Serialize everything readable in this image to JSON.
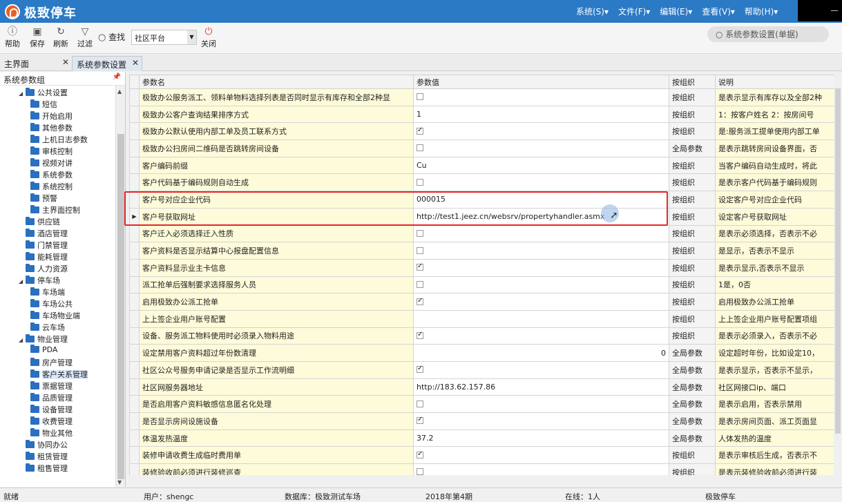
{
  "app": {
    "title": "极致停车"
  },
  "menu": [
    "系统(S)▾",
    "文件(F)▾",
    "编辑(E)▾",
    "查看(V)▾",
    "帮助(H)▾"
  ],
  "toolbar": {
    "help": "帮助",
    "save": "保存",
    "refresh": "刷新",
    "filter": "过滤",
    "search": "查找",
    "platform_value": "社区平台",
    "close": "关闭",
    "global_search": "系统参数设置(单据)"
  },
  "tabs": [
    {
      "label": "主界面"
    },
    {
      "label": "系统参数设置"
    }
  ],
  "sidebar": {
    "header": "系统参数组",
    "items": [
      "公共设置",
      "短信",
      "开始启用",
      "其他参数",
      "上机日志参数",
      "审核控制",
      "视频对讲",
      "系统参数",
      "系统控制",
      "预警",
      "主界面控制",
      "供应链",
      "酒店管理",
      "门禁管理",
      "能耗管理",
      "人力资源",
      "停车场",
      "车场端",
      "车场公共",
      "车场物业端",
      "云车场",
      "物业管理",
      "PDA",
      "房产管理",
      "客户关系管理",
      "票据管理",
      "品质管理",
      "设备管理",
      "收费管理",
      "物业其他",
      "协同办公",
      "租赁管理",
      "租售管理"
    ]
  },
  "grid": {
    "headers": [
      "参数名",
      "参数值",
      "按组织",
      "说明"
    ],
    "rows": [
      {
        "name": "极致办公服务派工、领料单物料选择列表是否同时显示有库存和全部2种显",
        "val": "",
        "cb": false,
        "org": "按组织",
        "desc": "是表示显示有库存以及全部2种"
      },
      {
        "name": "极致办公客户查询结果排序方式",
        "val": "1",
        "org": "按组织",
        "desc": "1：按客户姓名 2：按房间号"
      },
      {
        "name": "极致办公默认使用内部工单及员工联系方式",
        "cb": true,
        "org": "按组织",
        "desc": "是:服务派工提单使用内部工单"
      },
      {
        "name": "极致办公扫房间二维码是否跳转房间设备",
        "cb": false,
        "org": "全局参数",
        "desc": "是表示跳转房间设备界面，否"
      },
      {
        "name": "客户编码前缀",
        "val": "Cu",
        "org": "按组织",
        "desc": "当客户编码自动生成时，将此"
      },
      {
        "name": "客户代码基于编码规则自动生成",
        "cb": false,
        "org": "按组织",
        "desc": "是表示客户代码基于编码规则"
      },
      {
        "name": "客户号对应企业代码",
        "val": "000015",
        "org": "按组织",
        "desc": "设定客户号对应企业代码"
      },
      {
        "name": "客户号获取网址",
        "val": "http://test1.jeez.cn/websrv/propertyhandler.asmx",
        "org": "按组织",
        "desc": "设定客户号获取网址",
        "current": true
      },
      {
        "name": "客户迁入必须选择迁入性质",
        "cb": false,
        "org": "按组织",
        "desc": "是表示必须选择，否表示不必"
      },
      {
        "name": "客户资料是否显示结算中心报盘配置信息",
        "cb": false,
        "org": "按组织",
        "desc": "是显示，否表示不显示"
      },
      {
        "name": "客户资料显示业主卡信息",
        "cb": true,
        "org": "按组织",
        "desc": "是表示显示,否表示不显示"
      },
      {
        "name": "派工抢单后强制要求选择服务人员",
        "cb": false,
        "org": "按组织",
        "desc": "1是，0否"
      },
      {
        "name": "启用极致办公派工抢单",
        "cb": true,
        "org": "按组织",
        "desc": "启用极致办公派工抢单"
      },
      {
        "name": "上上签企业用户账号配置",
        "val": "",
        "org": "按组织",
        "desc": "上上签企业用户账号配置项组"
      },
      {
        "name": "设备、服务派工物料使用时必须录入物料用途",
        "cb": true,
        "org": "按组织",
        "desc": "是表示必须录入，否表示不必"
      },
      {
        "name": "设定禁用客户资料超过年份数清理",
        "val": "0",
        "num": true,
        "org": "全局参数",
        "desc": "设定超时年份，比如设定10，"
      },
      {
        "name": "社区公众号服务申请记录是否显示工作流明细",
        "cb": true,
        "org": "全局参数",
        "desc": "是表示显示，否表示不显示，"
      },
      {
        "name": "社区网服务器地址",
        "val": "http://183.62.157.86",
        "org": "全局参数",
        "desc": "社区网接口ip、端口"
      },
      {
        "name": "是否启用客户资料敏感信息匿名化处理",
        "cb": false,
        "org": "全局参数",
        "desc": "是表示启用，否表示禁用"
      },
      {
        "name": "是否显示房间设施设备",
        "cb": true,
        "org": "全局参数",
        "desc": "是表示房间页面、派工页面显"
      },
      {
        "name": "体温发热温度",
        "val": "37.2",
        "org": "全局参数",
        "desc": "人体发热的温度"
      },
      {
        "name": "装修申请收费生成临时费用单",
        "cb": true,
        "org": "按组织",
        "desc": "是表示审核后生成，否表示不"
      },
      {
        "name": "装修验收前必须进行装修巡查",
        "cb": false,
        "org": "按组织",
        "desc": "是表示装修验收前必须进行装"
      }
    ]
  },
  "status": {
    "state": "就绪",
    "user": "用户：shengc",
    "db": "数据库：极致测试车场",
    "period": "2018年第4期",
    "online": "在线：1人",
    "brand": "极致停车"
  }
}
